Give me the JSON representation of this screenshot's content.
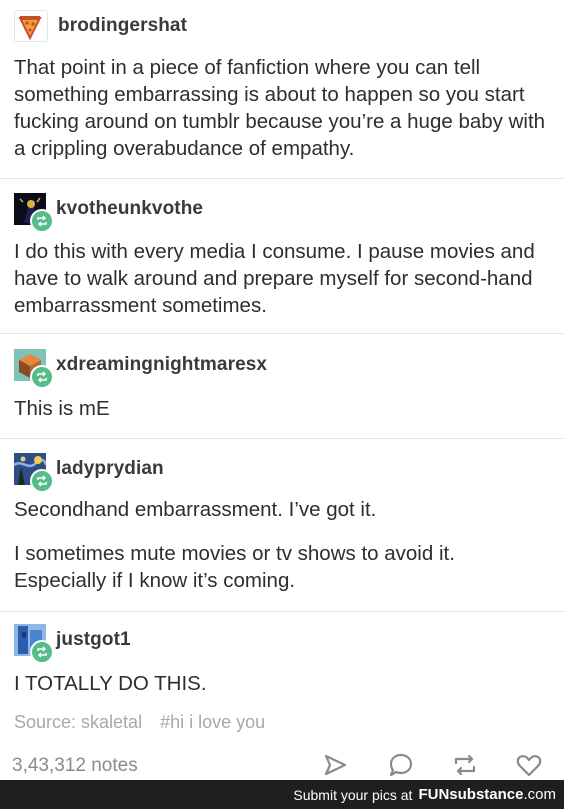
{
  "posts": [
    {
      "username": "brodingershat",
      "avatar_icon": "pizza-slice-icon",
      "paragraphs": [
        "That point in a piece of fanfiction where you can tell something embarrassing is about to happen so you start fucking around on tumblr because you’re a huge baby with a crippling overabudance of empathy."
      ]
    },
    {
      "username": "kvotheunkvothe",
      "avatar_icon": "dark-figure-avatar-icon",
      "paragraphs": [
        "I do this with every media I consume. I pause movies and have to walk around and prepare myself for second-hand embarrassment sometimes."
      ]
    },
    {
      "username": "xdreamingnightmaresx",
      "avatar_icon": "cube-avatar-icon",
      "paragraphs": [
        "This is mE"
      ]
    },
    {
      "username": "ladyprydian",
      "avatar_icon": "starry-night-avatar-icon",
      "paragraphs": [
        "Secondhand embarrassment. I’ve got it.",
        "I sometimes mute movies or tv shows to avoid it. Especially if I know it’s coming."
      ]
    },
    {
      "username": "justgot1",
      "avatar_icon": "blue-figure-avatar-icon",
      "paragraphs": [
        "I TOTALLY DO THIS."
      ]
    }
  ],
  "meta": {
    "source": "Source: skaletal",
    "tag": "#hi i love you",
    "notes": "3,43,312 notes"
  },
  "actions": [
    "share-icon",
    "reply-icon",
    "reblog-icon",
    "like-icon"
  ],
  "footer": {
    "prefix": "Submit your pics at",
    "brand_fun": "FUN",
    "brand_rest": "substance",
    "brand_suffix": ".com"
  },
  "colors": {
    "reblog_badge": "#56bc8a",
    "footer_bg": "#1f1f1f"
  }
}
